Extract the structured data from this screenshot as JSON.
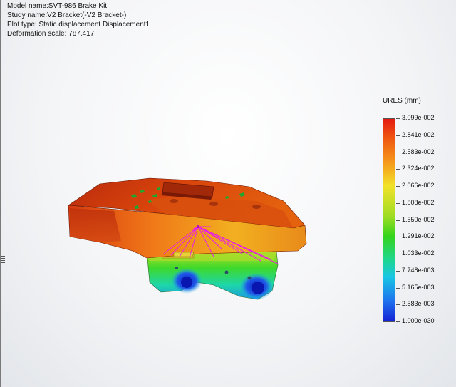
{
  "info": {
    "model_name": "Model name:SVT-986 Brake Kit",
    "study_name": "Study name:V2 Bracket(-V2 Bracket-)",
    "plot_type": "Plot type: Static displacement Displacement1",
    "deformation_scale": "Deformation scale: 787.417"
  },
  "legend": {
    "title": "URES (mm)",
    "ticks": [
      "3.099e-002",
      "2.841e-002",
      "2.583e-002",
      "2.324e-002",
      "2.066e-002",
      "1.808e-002",
      "1.550e-002",
      "1.291e-002",
      "1.033e-002",
      "7.748e-003",
      "5.165e-003",
      "2.583e-003",
      "1.000e-030"
    ]
  },
  "colors": {
    "max": "#e41a10",
    "min": "#1422d4",
    "load_arrows": "#e81ee6",
    "fixtures": "#1fa82e"
  }
}
